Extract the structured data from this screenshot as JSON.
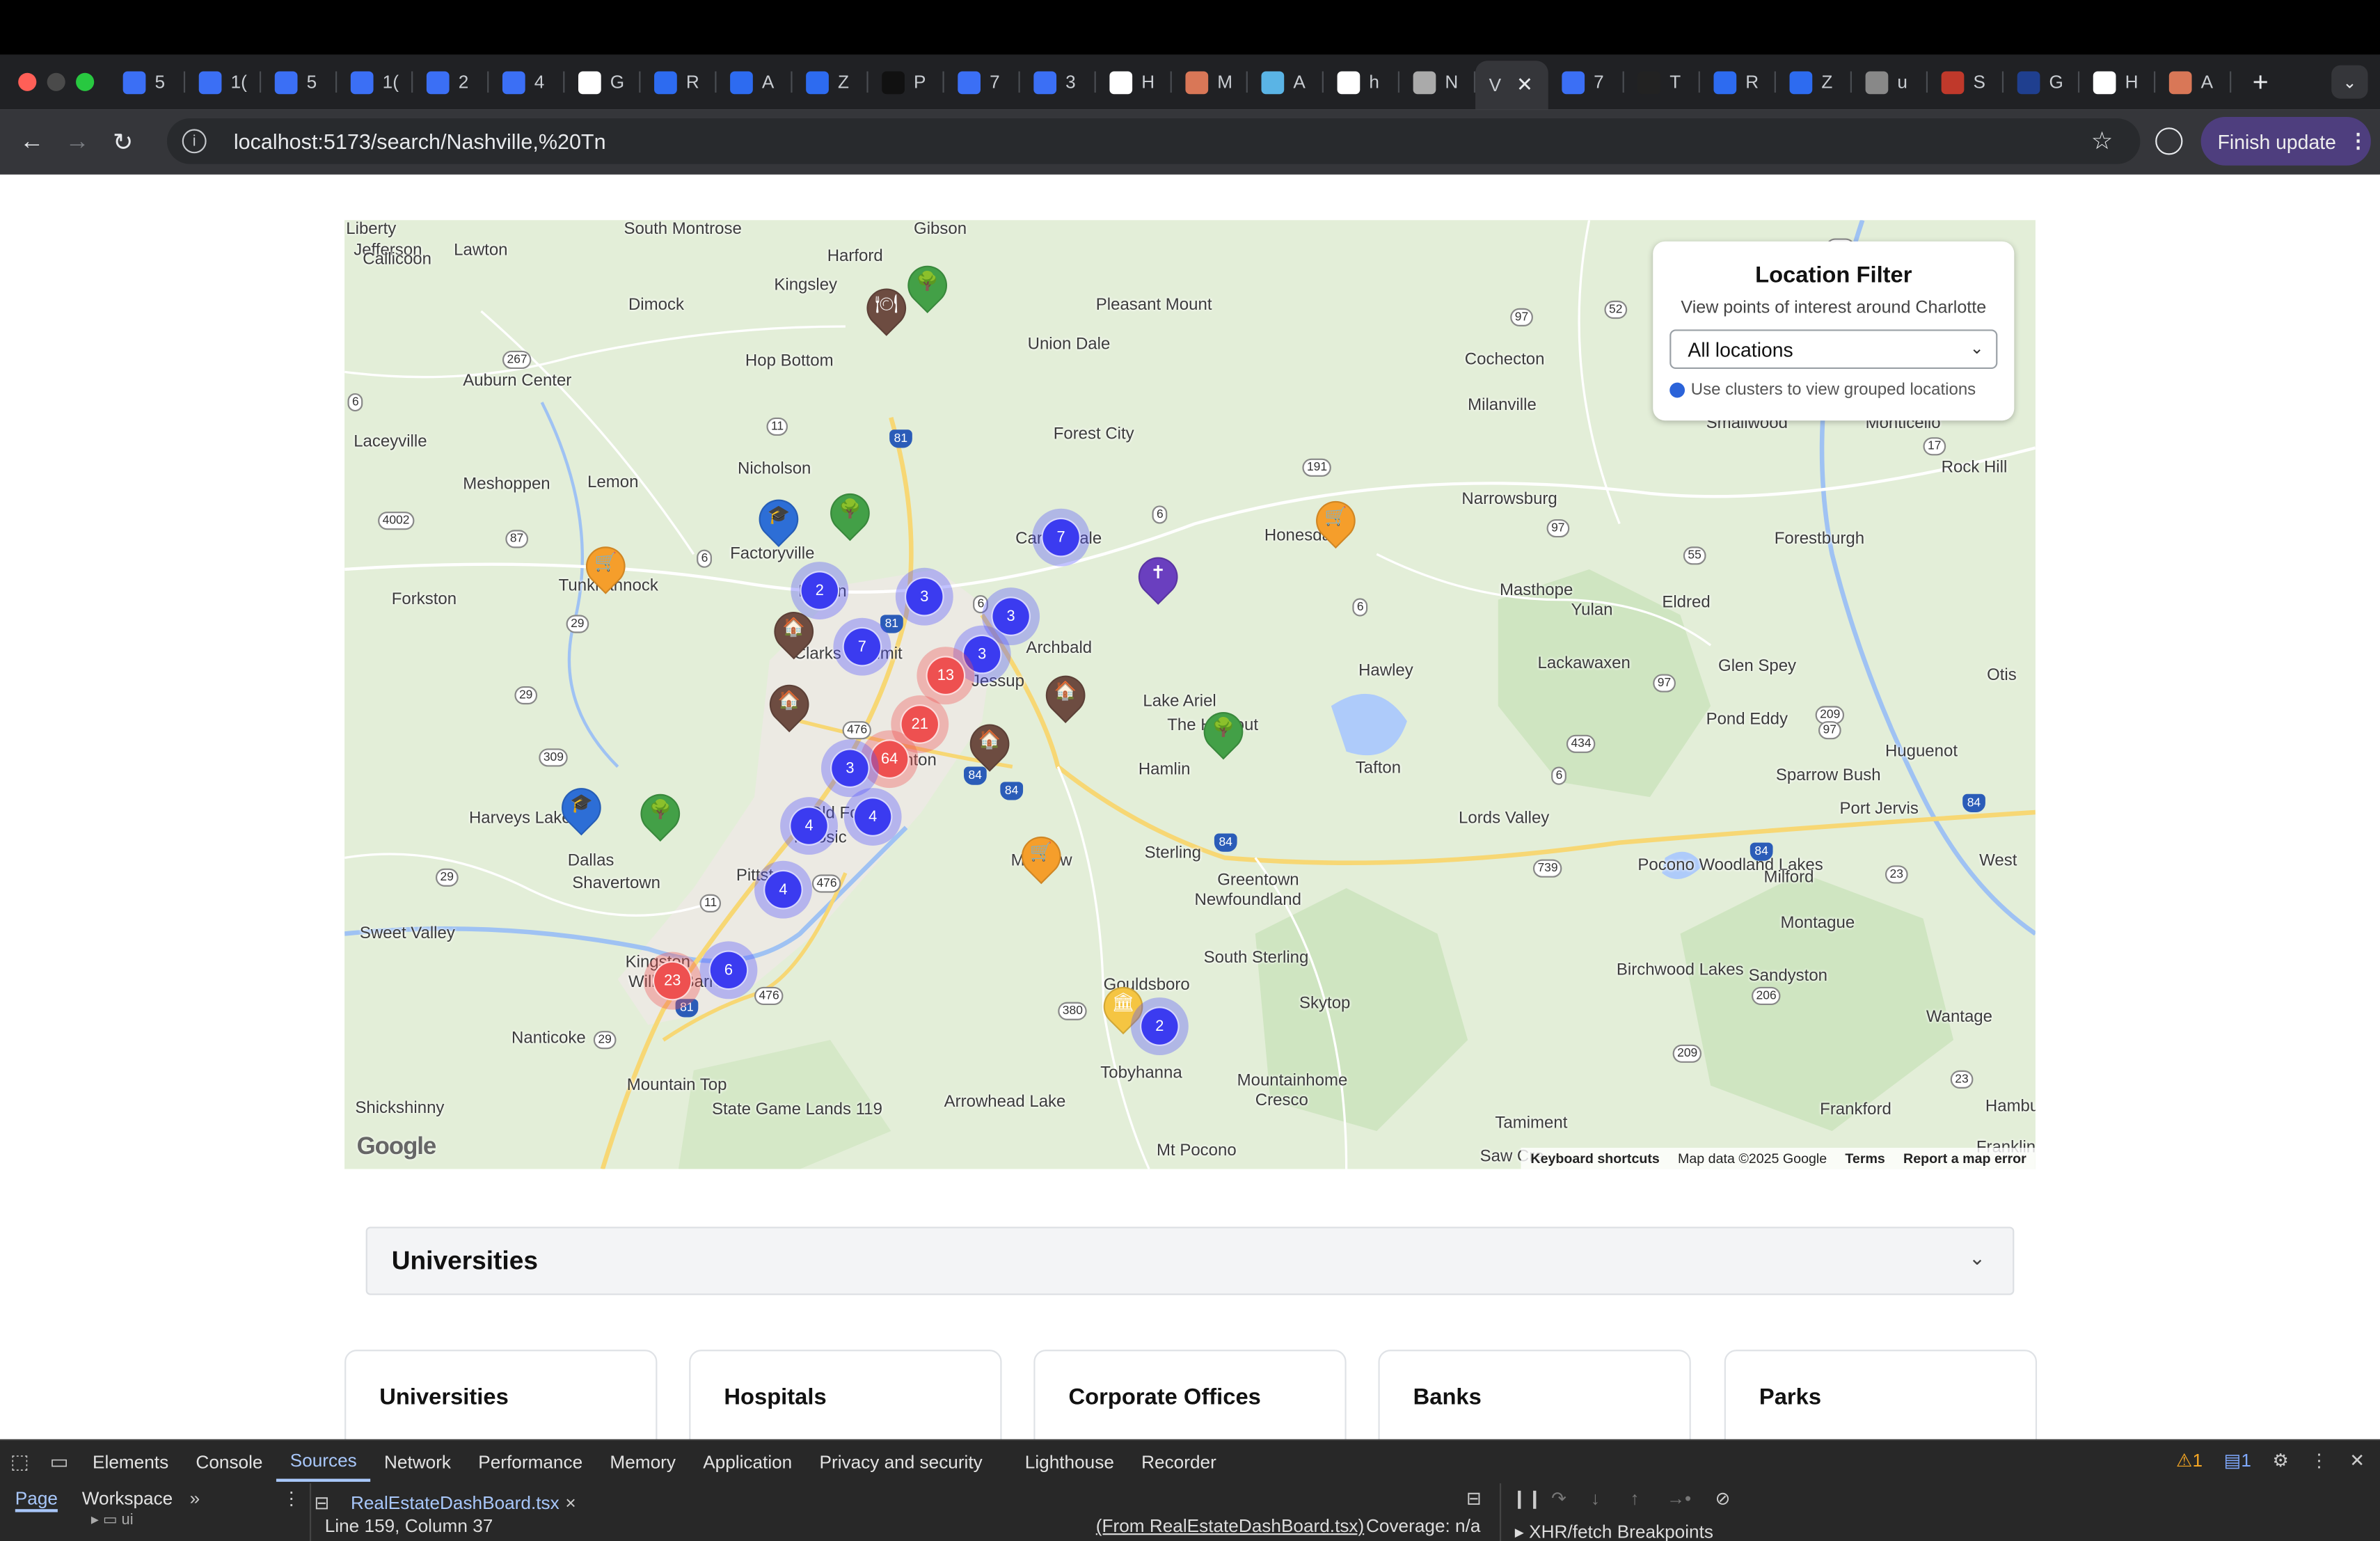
{
  "browser": {
    "tabs": [
      {
        "letter": "5",
        "icon": "blue-stack-icon",
        "color": "#3b6ff5"
      },
      {
        "letter": "1(",
        "icon": "blue-stack-icon",
        "color": "#3b6ff5"
      },
      {
        "letter": "5",
        "icon": "blue-stack-icon",
        "color": "#3b6ff5"
      },
      {
        "letter": "1(",
        "icon": "blue-stack-icon",
        "color": "#3b6ff5"
      },
      {
        "letter": "2",
        "icon": "blue-stack-icon",
        "color": "#3b6ff5"
      },
      {
        "letter": "4",
        "icon": "blue-stack-icon",
        "color": "#3b6ff5"
      },
      {
        "letter": "G",
        "icon": "google-icon",
        "color": "#ffffff"
      },
      {
        "letter": "R",
        "icon": "blue-q-icon",
        "color": "#2d6bf0"
      },
      {
        "letter": "A",
        "icon": "blue-q-icon",
        "color": "#2d6bf0"
      },
      {
        "letter": "Z",
        "icon": "blue-q-icon",
        "color": "#2d6bf0"
      },
      {
        "letter": "P",
        "icon": "p-icon",
        "color": "#111111"
      },
      {
        "letter": "7",
        "icon": "blue-stack-icon",
        "color": "#3b6ff5"
      },
      {
        "letter": "3",
        "icon": "blue-stack-icon",
        "color": "#3b6ff5"
      },
      {
        "letter": "H",
        "icon": "anthropic-icon",
        "color": "#ffffff"
      },
      {
        "letter": "M",
        "icon": "claude-icon",
        "color": "#d97757"
      },
      {
        "letter": "A",
        "icon": "wave-icon",
        "color": "#5ab4e5"
      },
      {
        "letter": "h",
        "icon": "google-icon",
        "color": "#ffffff"
      },
      {
        "letter": "N",
        "icon": "openai-icon",
        "color": "#aaaaaa"
      },
      {
        "letter": "V",
        "icon": "",
        "color": "#35363a",
        "active": true
      },
      {
        "letter": "7",
        "icon": "blue-stack-icon",
        "color": "#3b6ff5"
      },
      {
        "letter": "T",
        "icon": "slash-icon",
        "color": "#222222"
      },
      {
        "letter": "R",
        "icon": "blue-q-icon",
        "color": "#2d6bf0"
      },
      {
        "letter": "Z",
        "icon": "blue-q-icon",
        "color": "#2d6bf0"
      },
      {
        "letter": "u",
        "icon": "globe-icon",
        "color": "#888888"
      },
      {
        "letter": "S",
        "icon": "bars-icon",
        "color": "#c0392b"
      },
      {
        "letter": "G",
        "icon": "fsd-icon",
        "color": "#1f3f8f"
      },
      {
        "letter": "H",
        "icon": "anthropic-icon",
        "color": "#ffffff"
      },
      {
        "letter": "A",
        "icon": "claude-icon",
        "color": "#d97757"
      }
    ],
    "url": "localhost:5173/search/Nashville,%20Tn",
    "finish_update": "Finish update"
  },
  "map": {
    "filter": {
      "title": "Location Filter",
      "subtitle": "View points of interest around Charlotte",
      "select_value": "All locations",
      "hint": "Use clusters to view grouped locations"
    },
    "places": [
      {
        "name": "Liberty"
      },
      {
        "name": "Jefferson"
      },
      {
        "name": "Callicoon"
      },
      {
        "name": "Lawton"
      },
      {
        "name": "South Montrose"
      },
      {
        "name": "Harford"
      },
      {
        "name": "Gibson"
      },
      {
        "name": "Kingsley"
      },
      {
        "name": "Dimock"
      },
      {
        "name": "Pleasant Mount"
      },
      {
        "name": "Union Dale"
      },
      {
        "name": "Hop Bottom"
      },
      {
        "name": "Cochecton"
      },
      {
        "name": "Milanville"
      },
      {
        "name": "Smallwood"
      },
      {
        "name": "Monticello"
      },
      {
        "name": "Auburn Center"
      },
      {
        "name": "Laceyville"
      },
      {
        "name": "Nicholson"
      },
      {
        "name": "Forest City"
      },
      {
        "name": "Rock Hill"
      },
      {
        "name": "Meshoppen"
      },
      {
        "name": "Lemon"
      },
      {
        "name": "Narrowsburg"
      },
      {
        "name": "Factoryville"
      },
      {
        "name": "Carbondale"
      },
      {
        "name": "Honesdale"
      },
      {
        "name": "Forestburgh"
      },
      {
        "name": "Tunkhannock"
      },
      {
        "name": "Masthope"
      },
      {
        "name": "Forkston"
      },
      {
        "name": "Dalton"
      },
      {
        "name": "Yulan"
      },
      {
        "name": "Eldred"
      },
      {
        "name": "Clarks Summit"
      },
      {
        "name": "Archbald"
      },
      {
        "name": "Hawley"
      },
      {
        "name": "Lackawaxen"
      },
      {
        "name": "Glen Spey"
      },
      {
        "name": "Otis"
      },
      {
        "name": "Jessup"
      },
      {
        "name": "Lake Ariel"
      },
      {
        "name": "The Hideout"
      },
      {
        "name": "Pond Eddy"
      },
      {
        "name": "Huguenot"
      },
      {
        "name": "Scranton"
      },
      {
        "name": "Hamlin"
      },
      {
        "name": "Tafton"
      },
      {
        "name": "Sparrow Bush"
      },
      {
        "name": "Port Jervis"
      },
      {
        "name": "Harveys Lake"
      },
      {
        "name": "Old Forge"
      },
      {
        "name": "Moosic"
      },
      {
        "name": "Lords Valley"
      },
      {
        "name": "Dallas"
      },
      {
        "name": "Shavertown"
      },
      {
        "name": "Pittston"
      },
      {
        "name": "Moscow"
      },
      {
        "name": "Sterling"
      },
      {
        "name": "Greentown"
      },
      {
        "name": "Newfoundland"
      },
      {
        "name": "Pocono Woodland Lakes"
      },
      {
        "name": "Milford"
      },
      {
        "name": "West"
      },
      {
        "name": "Sweet Valley"
      },
      {
        "name": "Montague"
      },
      {
        "name": "Kingston"
      },
      {
        "name": "Wilkes-Barre"
      },
      {
        "name": "South Sterling"
      },
      {
        "name": "Birchwood Lakes"
      },
      {
        "name": "Sandyston"
      },
      {
        "name": "Gouldsboro"
      },
      {
        "name": "Skytop"
      },
      {
        "name": "Wantage"
      },
      {
        "name": "Nanticoke"
      },
      {
        "name": "Tobyhanna"
      },
      {
        "name": "Mountain Top"
      },
      {
        "name": "Mountainhome"
      },
      {
        "name": "Cresco"
      },
      {
        "name": "Hamburg"
      },
      {
        "name": "Shickshinny"
      },
      {
        "name": "Arrowhead Lake"
      },
      {
        "name": "State Game Lands 119"
      },
      {
        "name": "Frankford"
      },
      {
        "name": "Tamiment"
      },
      {
        "name": "Mt Pocono"
      },
      {
        "name": "Saw Cre"
      },
      {
        "name": "Franklin"
      }
    ],
    "clusters": [
      {
        "count": "7",
        "color": "blue"
      },
      {
        "count": "2",
        "color": "blue"
      },
      {
        "count": "3",
        "color": "blue"
      },
      {
        "count": "3",
        "color": "blue"
      },
      {
        "count": "7",
        "color": "blue"
      },
      {
        "count": "3",
        "color": "blue"
      },
      {
        "count": "13",
        "color": "red"
      },
      {
        "count": "21",
        "color": "red"
      },
      {
        "count": "64",
        "color": "red"
      },
      {
        "count": "3",
        "color": "blue"
      },
      {
        "count": "4",
        "color": "blue"
      },
      {
        "count": "4",
        "color": "blue"
      },
      {
        "count": "4",
        "color": "blue"
      },
      {
        "count": "6",
        "color": "blue"
      },
      {
        "count": "23",
        "color": "red"
      },
      {
        "count": "2",
        "color": "blue"
      }
    ],
    "pins": [
      {
        "icon": "restaurant-icon",
        "color": "#6d4c41",
        "glyph": "🍽"
      },
      {
        "icon": "park-icon",
        "color": "#43a047",
        "glyph": "🌳"
      },
      {
        "icon": "university-icon",
        "color": "#2d6ed6",
        "glyph": "🎓"
      },
      {
        "icon": "park-icon",
        "color": "#43a047",
        "glyph": "🌳"
      },
      {
        "icon": "shopping-cart-icon",
        "color": "#f59e2b",
        "glyph": "🛒"
      },
      {
        "icon": "shopping-cart-icon",
        "color": "#f59e2b",
        "glyph": "🛒"
      },
      {
        "icon": "church-icon",
        "color": "#6a3fbf",
        "glyph": "✝"
      },
      {
        "icon": "house-icon",
        "color": "#6d4c41",
        "glyph": "🏠"
      },
      {
        "icon": "house-icon",
        "color": "#6d4c41",
        "glyph": "🏠"
      },
      {
        "icon": "house-icon",
        "color": "#6d4c41",
        "glyph": "🏠"
      },
      {
        "icon": "house-icon",
        "color": "#6d4c41",
        "glyph": "🏠"
      },
      {
        "icon": "park-icon",
        "color": "#43a047",
        "glyph": "🌳"
      },
      {
        "icon": "university-icon",
        "color": "#2d6ed6",
        "glyph": "🎓"
      },
      {
        "icon": "park-icon",
        "color": "#43a047",
        "glyph": "🌳"
      },
      {
        "icon": "shopping-cart-icon",
        "color": "#f59e2b",
        "glyph": "🛒"
      },
      {
        "icon": "bank-icon",
        "color": "#f5c542",
        "glyph": "🏛"
      }
    ],
    "google_logo": "Google",
    "attribution": {
      "shortcuts": "Keyboard shortcuts",
      "data": "Map data ©2025 Google",
      "terms": "Terms",
      "report": "Report a map error"
    }
  },
  "accordion": {
    "label": "Universities"
  },
  "cards": [
    {
      "label": "Universities"
    },
    {
      "label": "Hospitals"
    },
    {
      "label": "Corporate Offices"
    },
    {
      "label": "Banks"
    },
    {
      "label": "Parks"
    }
  ],
  "devtools": {
    "tabs": [
      "Elements",
      "Console",
      "Sources",
      "Network",
      "Performance",
      "Memory",
      "Application",
      "Privacy and security",
      "Lighthouse",
      "Recorder"
    ],
    "active_tab": "Sources",
    "warnings": "1",
    "messages": "1",
    "nav_page": "Page",
    "nav_workspace": "Workspace",
    "file_tab": "RealEstateDashBoard.tsx",
    "status_position": "Line 159, Column 37",
    "status_from": "(From RealEstateDashBoard.tsx)",
    "status_coverage": "Coverage: n/a",
    "breakpoints": "XHR/fetch Breakpoints",
    "tree_item": "ui"
  }
}
